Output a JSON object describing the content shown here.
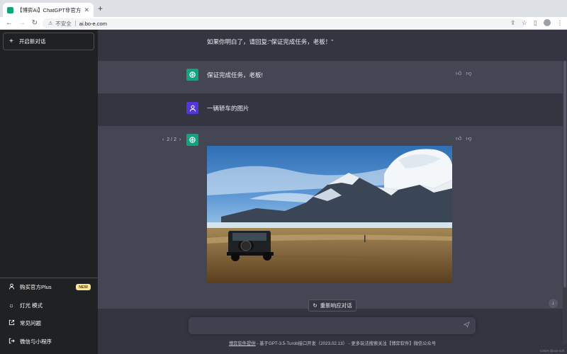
{
  "browser": {
    "tab_title": "【博弈Ai】ChatGPT非官方国内",
    "insecure_label": "不安全",
    "url": "ai.bo-e.com"
  },
  "sidebar": {
    "new_chat": "开启新对话",
    "items": [
      {
        "icon": "user-icon",
        "label": "购买官方Plus",
        "badge": "NEW"
      },
      {
        "icon": "sun-icon",
        "label": "灯光 模式"
      },
      {
        "icon": "external-link-icon",
        "label": "常见问题"
      },
      {
        "icon": "logout-icon",
        "label": "微信与小程序"
      }
    ]
  },
  "conversation": {
    "prompt_tail": "如果你明白了，请回复:“保证完成任务，老板！”",
    "bot_reply_1": "保证完成任务，老板!",
    "user_msg_2": "一辆轿车的图片",
    "pager": {
      "prev": "‹",
      "label": "2 / 2",
      "next": "›"
    }
  },
  "regenerate_label": "重新响应对话",
  "input": {
    "placeholder": "",
    "value": ""
  },
  "footer": {
    "link": "博弈软件提供",
    "text": " - 基于GPT-3.5-Turob接口开发（2023.02.13） - 更多玩法搜索关注【博弈软件】微信公众号"
  },
  "watermark": "CSDN @xxx-soft",
  "colors": {
    "sidebar_bg": "#202123",
    "main_bg": "#343541",
    "bot_row_bg": "#444654",
    "gpt_avatar": "#10a37f",
    "user_avatar": "#5436da",
    "badge": "#fae69e"
  }
}
